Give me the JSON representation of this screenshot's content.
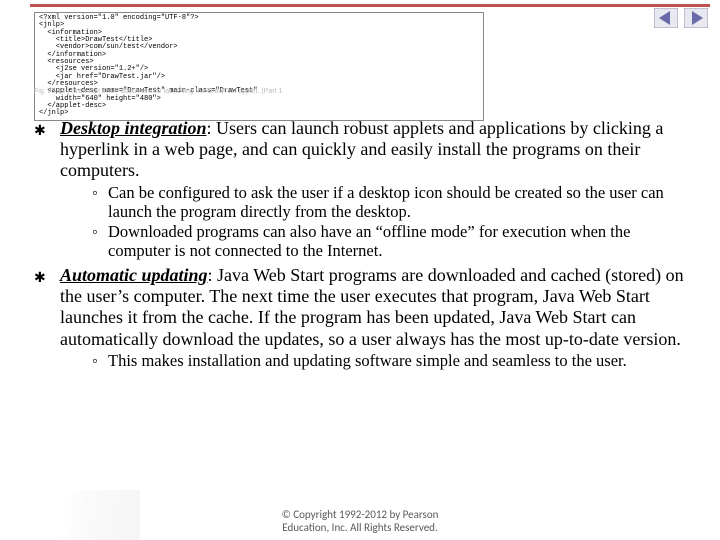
{
  "nav": {
    "prev": "prev-arrow-icon",
    "next": "next-arrow-icon"
  },
  "code": {
    "lines": "<?xml version=\"1.0\" encoding=\"UTF-8\"?>\n<jnlp>\n  <information>\n    <title>DrawTest</title>\n    <vendor>com/sun/test</vendor>\n  </information>\n  <resources>\n    <j2se version=\"1.2+\"/> \n    <jar href=\"DrawTest.jar\"/>\n  </resources>\n  <applet-desc name=\"DrawTest\" main-class=\"DrawTest\"\n    width=\"640\" height=\"480\">\n  </applet-desc>\n</jnlp>",
    "caption": "Fig. 23.13 | DrawTest JNLP document for launching the DrawTest applet. (Part 1"
  },
  "items": [
    {
      "term": "Desktop integration",
      "text": ": Users can launch robust applets and applications by clicking a hyperlink in a web page, and can quickly and easily install the programs on their computers.",
      "subs": [
        "Can be configured to ask the user if a desktop icon should be created so the user can launch the program directly from the desktop.",
        "Downloaded programs can also have an “offline mode” for execution when the computer is not connected to the Internet."
      ]
    },
    {
      "term": "Automatic updating",
      "text": ": Java Web Start programs are downloaded and cached (stored) on the user’s computer. The next time the user executes that program, Java Web Start launches it from the cache. If the program has been updated, Java Web Start can automatically download the updates, so a user always has the most up-to-date version.",
      "subs": [
        "This makes installation and updating software simple and seamless to the user."
      ]
    }
  ],
  "footer": {
    "line1": "© Copyright 1992-2012 by Pearson",
    "line2": "Education, Inc. All Rights Reserved."
  }
}
